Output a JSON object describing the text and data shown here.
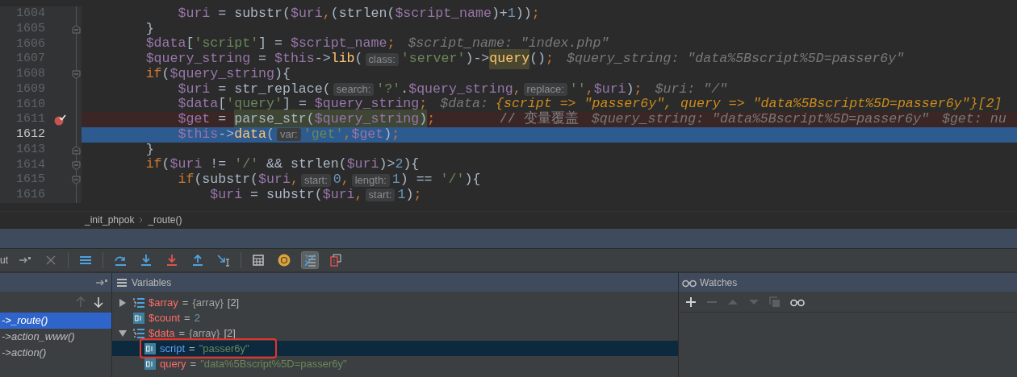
{
  "editor": {
    "lines": [
      {
        "number": "1604",
        "kind": "nested",
        "fold_start": false,
        "fold_end": false,
        "breakpoint": false,
        "current": false,
        "tokens": [
          {
            "kind": "var",
            "text": "$uri"
          },
          {
            "kind": "plain",
            "text": " = substr("
          },
          {
            "kind": "var",
            "text": "$uri"
          },
          {
            "kind": "punct",
            "text": ","
          },
          {
            "kind": "plain",
            "text": "(strlen("
          },
          {
            "kind": "var",
            "text": "$script_name"
          },
          {
            "kind": "plain",
            "text": ")+"
          },
          {
            "kind": "num",
            "text": "1"
          },
          {
            "kind": "plain",
            "text": "))"
          },
          {
            "kind": "punct",
            "text": ";"
          }
        ]
      },
      {
        "number": "1605",
        "kind": "block",
        "fold_start": false,
        "fold_end": true,
        "breakpoint": false,
        "current": false,
        "tokens": [
          {
            "kind": "plain",
            "text": "}"
          }
        ]
      },
      {
        "number": "1606",
        "kind": "block",
        "fold_start": false,
        "fold_end": false,
        "breakpoint": false,
        "current": false,
        "tokens": [
          {
            "kind": "var",
            "text": "$data"
          },
          {
            "kind": "plain",
            "text": "["
          },
          {
            "kind": "str",
            "text": "'script'"
          },
          {
            "kind": "plain",
            "text": "] = "
          },
          {
            "kind": "var",
            "text": "$script_name"
          },
          {
            "kind": "punct",
            "text": ";"
          },
          {
            "kind": "inlay",
            "text": "$script_name: \"index.php\""
          }
        ]
      },
      {
        "number": "1607",
        "kind": "block",
        "fold_start": false,
        "fold_end": false,
        "breakpoint": false,
        "current": false,
        "tokens": [
          {
            "kind": "var",
            "text": "$query_string"
          },
          {
            "kind": "plain",
            "text": " = "
          },
          {
            "kind": "var",
            "text": "$this"
          },
          {
            "kind": "plain",
            "text": "->"
          },
          {
            "kind": "fn",
            "text": "lib"
          },
          {
            "kind": "plain",
            "text": "("
          },
          {
            "kind": "hint",
            "text": "class:"
          },
          {
            "kind": "str",
            "text": "'server'"
          },
          {
            "kind": "plain",
            "text": ")->"
          },
          {
            "kind": "fn-hl",
            "text": "query"
          },
          {
            "kind": "plain",
            "text": "()"
          },
          {
            "kind": "punct",
            "text": ";"
          },
          {
            "kind": "inlay",
            "text": "$query_string: \"data%5Bscript%5D=passer6y\""
          }
        ]
      },
      {
        "number": "1608",
        "kind": "block",
        "fold_start": true,
        "fold_end": false,
        "breakpoint": false,
        "current": false,
        "tokens": [
          {
            "kind": "kw",
            "text": "if"
          },
          {
            "kind": "plain",
            "text": "("
          },
          {
            "kind": "var",
            "text": "$query_string"
          },
          {
            "kind": "plain",
            "text": "){"
          }
        ]
      },
      {
        "number": "1609",
        "kind": "nested",
        "fold_start": false,
        "fold_end": false,
        "breakpoint": false,
        "current": false,
        "tokens": [
          {
            "kind": "var",
            "text": "$uri"
          },
          {
            "kind": "plain",
            "text": " = str_replace("
          },
          {
            "kind": "hint",
            "text": "search:"
          },
          {
            "kind": "str",
            "text": "'?'"
          },
          {
            "kind": "plain",
            "text": "."
          },
          {
            "kind": "var",
            "text": "$query_string"
          },
          {
            "kind": "punct",
            "text": ","
          },
          {
            "kind": "hint",
            "text": "replace:"
          },
          {
            "kind": "str",
            "text": "''"
          },
          {
            "kind": "punct",
            "text": ","
          },
          {
            "kind": "var",
            "text": "$uri"
          },
          {
            "kind": "plain",
            "text": ")"
          },
          {
            "kind": "punct",
            "text": ";"
          },
          {
            "kind": "inlay",
            "text": "$uri: \"/\""
          }
        ]
      },
      {
        "number": "1610",
        "kind": "nested",
        "fold_start": false,
        "fold_end": false,
        "breakpoint": false,
        "current": false,
        "tokens": [
          {
            "kind": "var",
            "text": "$data"
          },
          {
            "kind": "plain",
            "text": "["
          },
          {
            "kind": "str",
            "text": "'query'"
          },
          {
            "kind": "plain",
            "text": "] = "
          },
          {
            "kind": "var",
            "text": "$query_string"
          },
          {
            "kind": "punct",
            "text": ";"
          },
          {
            "kind": "inlay",
            "text": "$data:"
          },
          {
            "kind": "inlay-changed",
            "text": "{script => \"passer6y\", query => \"data%5Bscript%5D=passer6y\"}[2]"
          }
        ]
      },
      {
        "number": "1611",
        "kind": "nested",
        "fold_start": false,
        "fold_end": false,
        "breakpoint": true,
        "current": false,
        "tokens": [
          {
            "kind": "var",
            "text": "$get"
          },
          {
            "kind": "plain",
            "text": " = "
          },
          {
            "kind": "plain-hl",
            "text": "parse_str("
          },
          {
            "kind": "var-hl",
            "text": "$query_string"
          },
          {
            "kind": "plain-hl",
            "text": ")"
          },
          {
            "kind": "punct",
            "text": ";"
          },
          {
            "kind": "comment",
            "text": "// 变量覆盖"
          },
          {
            "kind": "inlay",
            "text": "$query_string: \"data%5Bscript%5D=passer6y\""
          },
          {
            "kind": "inlay",
            "text": "$get: nu"
          }
        ]
      },
      {
        "number": "1612",
        "kind": "nested",
        "fold_start": false,
        "fold_end": false,
        "breakpoint": false,
        "current": true,
        "tokens": [
          {
            "kind": "var",
            "text": "$this"
          },
          {
            "kind": "plain",
            "text": "->"
          },
          {
            "kind": "fn",
            "text": "data"
          },
          {
            "kind": "plain",
            "text": "("
          },
          {
            "kind": "hint",
            "text": "var:"
          },
          {
            "kind": "str",
            "text": "'get'"
          },
          {
            "kind": "punct",
            "text": ","
          },
          {
            "kind": "var",
            "text": "$get"
          },
          {
            "kind": "plain",
            "text": ")"
          },
          {
            "kind": "punct",
            "text": ";"
          }
        ]
      },
      {
        "number": "1613",
        "kind": "block",
        "fold_start": false,
        "fold_end": true,
        "breakpoint": false,
        "current": false,
        "tokens": [
          {
            "kind": "plain",
            "text": "}"
          }
        ]
      },
      {
        "number": "1614",
        "kind": "block",
        "fold_start": true,
        "fold_end": false,
        "breakpoint": false,
        "current": false,
        "tokens": [
          {
            "kind": "kw",
            "text": "if"
          },
          {
            "kind": "plain",
            "text": "("
          },
          {
            "kind": "var",
            "text": "$uri"
          },
          {
            "kind": "plain",
            "text": " != "
          },
          {
            "kind": "str",
            "text": "'/'"
          },
          {
            "kind": "plain",
            "text": " && strlen("
          },
          {
            "kind": "var",
            "text": "$uri"
          },
          {
            "kind": "plain",
            "text": ")>"
          },
          {
            "kind": "num",
            "text": "2"
          },
          {
            "kind": "plain",
            "text": "){"
          }
        ]
      },
      {
        "number": "1615",
        "kind": "nested",
        "fold_start": true,
        "fold_end": false,
        "breakpoint": false,
        "current": false,
        "tokens": [
          {
            "kind": "kw",
            "text": "if"
          },
          {
            "kind": "plain",
            "text": "(substr("
          },
          {
            "kind": "var",
            "text": "$uri"
          },
          {
            "kind": "punct",
            "text": ","
          },
          {
            "kind": "hint",
            "text": "start:"
          },
          {
            "kind": "num",
            "text": "0"
          },
          {
            "kind": "punct",
            "text": ","
          },
          {
            "kind": "hint",
            "text": "length:"
          },
          {
            "kind": "num",
            "text": "1"
          },
          {
            "kind": "plain",
            "text": ") == "
          },
          {
            "kind": "str",
            "text": "'/'"
          },
          {
            "kind": "plain",
            "text": "){"
          }
        ]
      },
      {
        "number": "1616",
        "kind": "deep",
        "fold_start": false,
        "fold_end": false,
        "breakpoint": false,
        "current": false,
        "tokens": [
          {
            "kind": "var",
            "text": "$uri"
          },
          {
            "kind": "plain",
            "text": " = substr("
          },
          {
            "kind": "var",
            "text": "$uri"
          },
          {
            "kind": "punct",
            "text": ","
          },
          {
            "kind": "hint",
            "text": "start:"
          },
          {
            "kind": "num",
            "text": "1"
          },
          {
            "kind": "plain",
            "text": ")"
          },
          {
            "kind": "punct",
            "text": ";"
          }
        ]
      }
    ]
  },
  "breadcrumbs": [
    "_init_phpok",
    "_route()"
  ],
  "toolbar": {
    "label": "ut",
    "buttons": [
      {
        "kind": "pin",
        "on": false
      },
      {
        "kind": "close",
        "on": false
      },
      {
        "kind": "sep"
      },
      {
        "kind": "frames",
        "on": false
      },
      {
        "kind": "sep"
      },
      {
        "kind": "step-over",
        "on": false
      },
      {
        "kind": "step-into",
        "on": false
      },
      {
        "kind": "force-step-into",
        "on": false
      },
      {
        "kind": "step-out",
        "on": false
      },
      {
        "kind": "run-to-cursor",
        "on": false
      },
      {
        "kind": "sep"
      },
      {
        "kind": "evaluate",
        "on": false
      },
      {
        "kind": "at",
        "on": false
      },
      {
        "kind": "values",
        "on": true
      },
      {
        "kind": "restore",
        "on": false
      }
    ]
  },
  "frames": {
    "items": [
      {
        "label": "->_route()",
        "selected": true
      },
      {
        "label": "->action_www()",
        "selected": false
      },
      {
        "label": "->action()",
        "selected": false
      }
    ]
  },
  "variables": {
    "title": "Variables",
    "items": [
      {
        "kind": "array",
        "name": "$array",
        "operator": "=",
        "type": "{array}",
        "value": {
          "kind": "plain",
          "text": "[2]"
        },
        "expanded": false,
        "selected": false
      },
      {
        "kind": "scalar",
        "name": "$count",
        "operator": "=",
        "value": {
          "kind": "num",
          "text": "2"
        },
        "selected": false
      },
      {
        "kind": "array",
        "name": "$data",
        "operator": "=",
        "type": "{array}",
        "value": {
          "kind": "plain",
          "text": "[2]"
        },
        "expanded": true,
        "selected": false,
        "children": [
          {
            "kind": "scalar",
            "name": "script",
            "operator": "=",
            "value": {
              "kind": "str",
              "text": "\"passer6y\""
            },
            "selected": true,
            "annotated": true
          },
          {
            "kind": "scalar",
            "name": "query",
            "operator": "=",
            "value": {
              "kind": "str",
              "text": "\"data%5Bscript%5D=passer6y\""
            },
            "selected": false
          }
        ]
      }
    ]
  },
  "watches": {
    "title": "Watches",
    "tools": [
      {
        "kind": "add",
        "disabled": false
      },
      {
        "kind": "remove",
        "disabled": true
      },
      {
        "kind": "up",
        "disabled": true
      },
      {
        "kind": "down",
        "disabled": true
      },
      {
        "kind": "copy",
        "disabled": true
      },
      {
        "kind": "glasses",
        "disabled": false
      }
    ]
  }
}
